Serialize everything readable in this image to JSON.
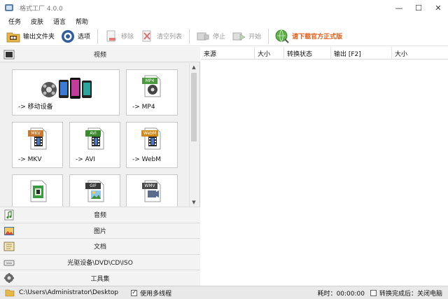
{
  "window": {
    "title": "格式工厂 4.0.0",
    "minimize": "—",
    "maximize": "☐",
    "close": "✕"
  },
  "menu": [
    "任务",
    "皮肤",
    "语言",
    "帮助"
  ],
  "toolbar": {
    "output_folder": "输出文件夹",
    "options": "选项",
    "remove": "移除",
    "clear_list": "清空列表",
    "stop": "停止",
    "start": "开始",
    "download": "请下载官方正式版"
  },
  "video_category": "视频",
  "tiles": [
    {
      "label": "-> 移动设备",
      "icon": "mobile-device-icon"
    },
    {
      "label": "-> MP4",
      "badge": "MP4",
      "badge_color": "#4b9a3d"
    },
    {
      "label": "-> MKV",
      "badge": "MKV",
      "badge_color": "#c77a2e"
    },
    {
      "label": "-> AVI",
      "badge": "AVI",
      "badge_color": "#3b8a2e"
    },
    {
      "label": "-> WebM",
      "badge": "WebM",
      "badge_color": "#d08a1c"
    },
    {
      "label": "",
      "badge": "",
      "badge_color": "#3c9a42"
    },
    {
      "label": "",
      "badge": "GIF",
      "badge_color": "#3a3a3a"
    },
    {
      "label": "",
      "badge": "WMV",
      "badge_color": "#4a4a4a"
    }
  ],
  "categories": [
    "音频",
    "图片",
    "文档",
    "光驱设备\\DVD\\CD\\ISO",
    "工具集"
  ],
  "table_columns": [
    "来源",
    "大小",
    "转换状态",
    "输出 [F2]",
    "大小"
  ],
  "status": {
    "path": "C:\\Users\\Administrator\\Desktop",
    "multithread": "使用多线程",
    "elapsed": "耗时：00:00:00",
    "after_done": "转换完成后：关闭电脑"
  },
  "colors": {
    "accent": "#e0601a",
    "panel_bg": "#f0f0f0"
  }
}
